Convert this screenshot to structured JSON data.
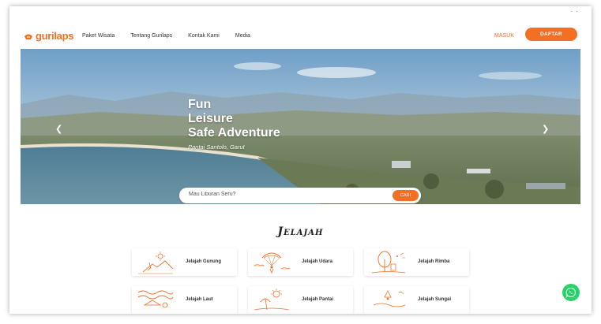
{
  "window": {
    "menu_dots": "· ·"
  },
  "brand": {
    "name": "gurilaps",
    "accent": "#f26f24"
  },
  "nav": {
    "links": [
      "Paket Wisata",
      "Tentang Gurilaps",
      "Kontak Kami",
      "Media"
    ],
    "login_label": "MASUK",
    "register_label": "DAFTAR"
  },
  "hero": {
    "title_lines": [
      "Fun",
      "Leisure",
      "Safe Adventure"
    ],
    "location": "Pantai Santolo, Garut",
    "prev_icon": "chevron-left-icon",
    "next_icon": "chevron-right-icon"
  },
  "search": {
    "placeholder": "Mau Liburan Seru?",
    "button_label": "CARI"
  },
  "jelajah": {
    "title": "Jelajah",
    "cards": [
      {
        "label": "Jelajah Gunung",
        "icon": "mountain-icon"
      },
      {
        "label": "Jelajah Udara",
        "icon": "paragliding-icon"
      },
      {
        "label": "Jelajah Rimba",
        "icon": "forest-icon"
      },
      {
        "label": "Jelajah Laut",
        "icon": "sea-icon"
      },
      {
        "label": "Jelajah Pantai",
        "icon": "beach-icon"
      },
      {
        "label": "Jelajah Sungai",
        "icon": "river-icon"
      }
    ]
  },
  "whatsapp": {
    "icon": "whatsapp-icon",
    "color": "#25d366"
  }
}
